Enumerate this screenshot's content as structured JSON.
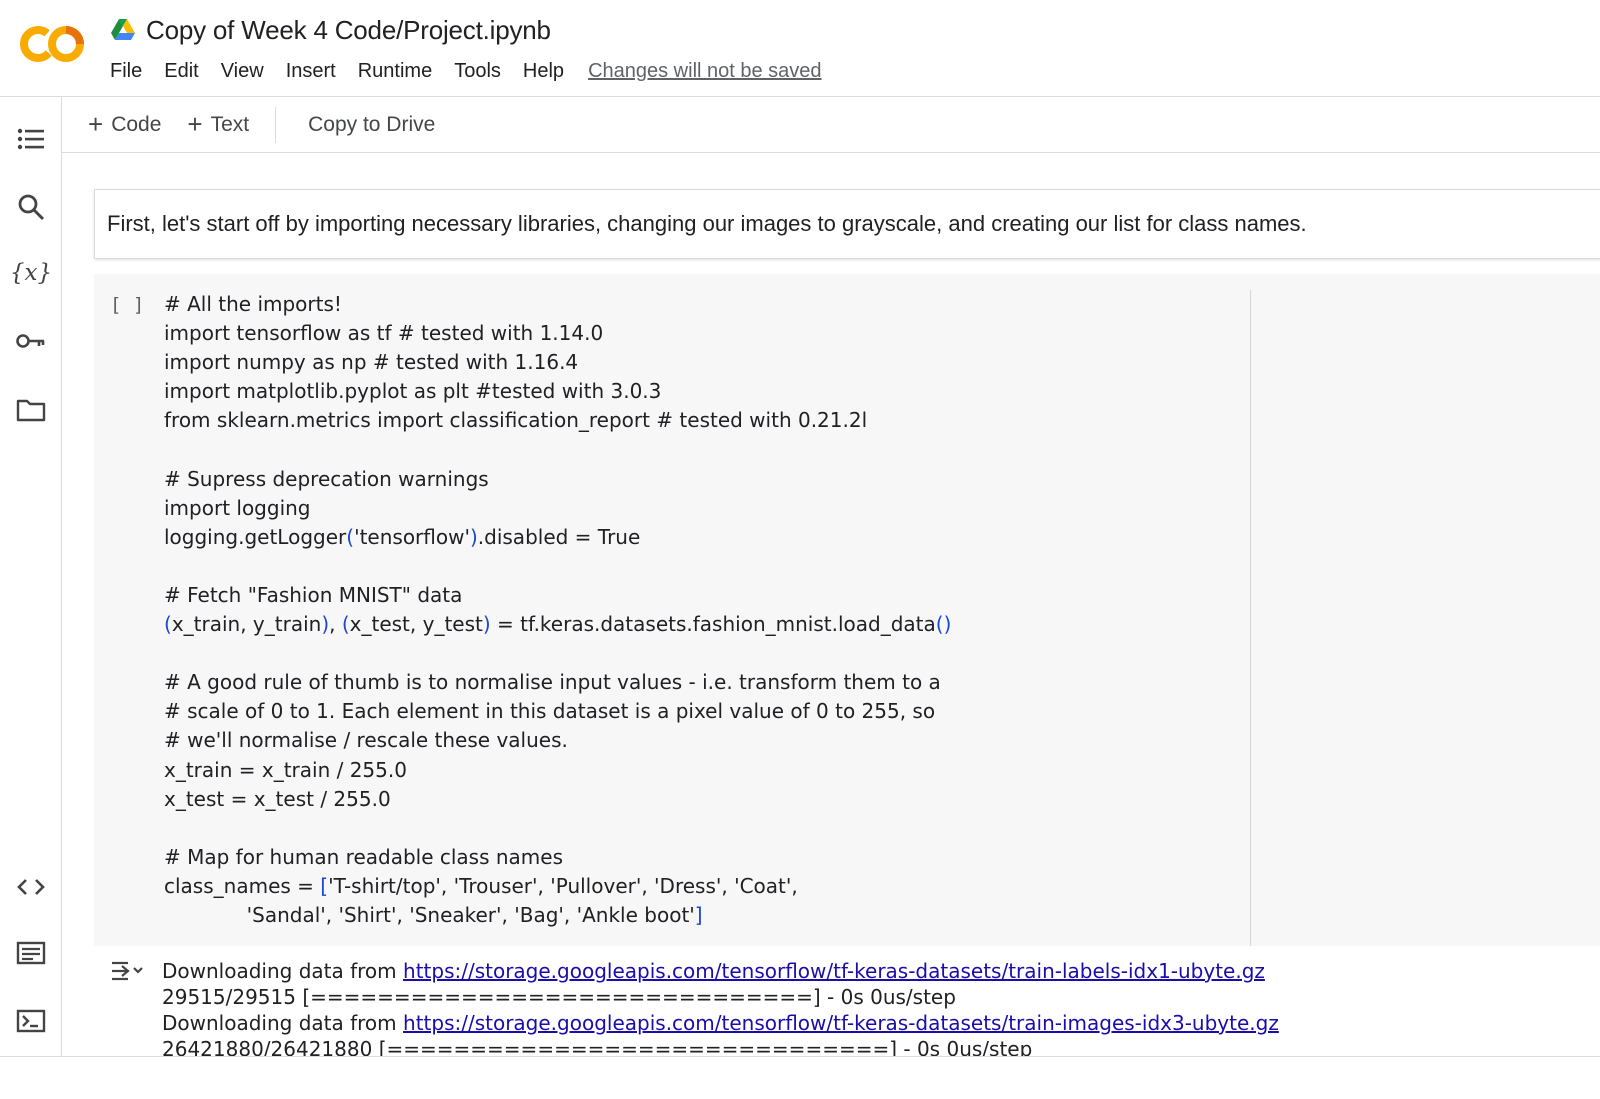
{
  "app": {
    "logo_text": "CO",
    "title": "Copy of Week 4 Code/Project.ipynb",
    "colors": {
      "logo_orange": "#F9AB00",
      "logo_dark_orange": "#E8710A",
      "link": "#1A0DAB",
      "bracket": "#1A47D4"
    }
  },
  "menu": {
    "items": [
      "File",
      "Edit",
      "View",
      "Insert",
      "Runtime",
      "Tools",
      "Help"
    ],
    "unsaved_notice": "Changes will not be saved"
  },
  "sidebar": {
    "top_icons": [
      "table-of-contents-icon",
      "search-icon",
      "variables-icon",
      "secrets-key-icon",
      "files-folder-icon"
    ],
    "bottom_icons": [
      "code-snippets-icon",
      "command-palette-icon",
      "terminal-icon"
    ],
    "variables_glyph": "{x}"
  },
  "toolbar": {
    "add_code_label": "Code",
    "add_text_label": "Text",
    "copy_to_drive_label": "Copy to Drive"
  },
  "cells": {
    "text_cell": "First, let's start off by importing necessary libraries, changing our images to grayscale, and creating our list for class names.",
    "code_cell": {
      "run_indicator": "[ ]",
      "lines": [
        "# All the imports!",
        "import tensorflow as tf # tested with 1.14.0",
        "import numpy as np # tested with 1.16.4",
        "import matplotlib.pyplot as plt #tested with 3.0.3",
        "from sklearn.metrics import classification_report # tested with 0.21.2l",
        "",
        "# Supress deprecation warnings",
        "import logging",
        "logging.getLogger('tensorflow').disabled = True",
        "",
        "# Fetch \"Fashion MNIST\" data",
        "(x_train, y_train), (x_test, y_test) = tf.keras.datasets.fashion_mnist.load_data()",
        "",
        "# A good rule of thumb is to normalise input values - i.e. transform them to a",
        "# scale of 0 to 1. Each element in this dataset is a pixel value of 0 to 255, so",
        "# we'll normalise / rescale these values.",
        "x_train = x_train / 255.0",
        "x_test = x_test / 255.0",
        "",
        "# Map for human readable class names",
        "class_names = ['T-shirt/top', 'Trouser', 'Pullover', 'Dress', 'Coat',",
        "             'Sandal', 'Shirt', 'Sneaker', 'Bag', 'Ankle boot']"
      ]
    },
    "output": {
      "lines": [
        {
          "prefix": "Downloading data from ",
          "link": "https://storage.googleapis.com/tensorflow/tf-keras-datasets/train-labels-idx1-ubyte.gz"
        },
        {
          "text": "29515/29515 [==============================] - 0s 0us/step"
        },
        {
          "prefix": "Downloading data from ",
          "link": "https://storage.googleapis.com/tensorflow/tf-keras-datasets/train-images-idx3-ubyte.gz"
        },
        {
          "text": "26421880/26421880 [==============================] - 0s 0us/step"
        }
      ]
    }
  }
}
